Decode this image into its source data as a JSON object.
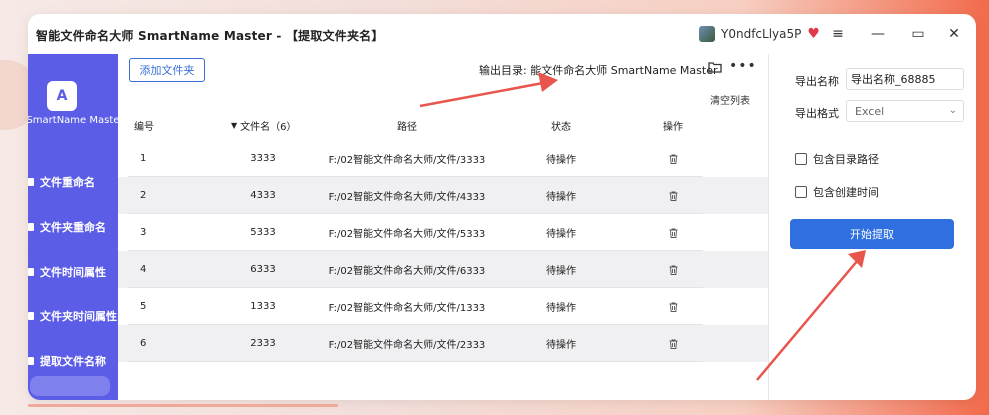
{
  "window": {
    "title": "智能文件命名大师 SmartName Master - 【提取文件夹名】",
    "user_name": "Y0ndfcLlya5P",
    "controls": [
      "menu-icon",
      "minimize-icon",
      "maximize-icon",
      "close-icon"
    ]
  },
  "sidebar": {
    "logo_label": "SmartName Master",
    "items": [
      {
        "label": "文件重命名"
      },
      {
        "label": "文件夹重命名"
      },
      {
        "label": "文件时间属性"
      },
      {
        "label": "文件夹时间属性"
      },
      {
        "label": "提取文件名称"
      }
    ]
  },
  "toolbar": {
    "add_folder_label": "添加文件夹",
    "output_dir_prefix": "输出目录:",
    "output_dir_value": "能文件命名大师 SmartName Master",
    "clear_list_label": "清空列表"
  },
  "table": {
    "headers": {
      "id": "编号",
      "name": "文件名（6）",
      "path": "路径",
      "status": "状态",
      "op": "操作"
    },
    "rows": [
      {
        "id": "1",
        "name": "3333",
        "path": "F:/02智能文件命名大师/文件/3333",
        "status": "待操作"
      },
      {
        "id": "2",
        "name": "4333",
        "path": "F:/02智能文件命名大师/文件/4333",
        "status": "待操作"
      },
      {
        "id": "3",
        "name": "5333",
        "path": "F:/02智能文件命名大师/文件/5333",
        "status": "待操作"
      },
      {
        "id": "4",
        "name": "6333",
        "path": "F:/02智能文件命名大师/文件/6333",
        "status": "待操作"
      },
      {
        "id": "5",
        "name": "1333",
        "path": "F:/02智能文件命名大师/文件/1333",
        "status": "待操作"
      },
      {
        "id": "6",
        "name": "2333",
        "path": "F:/02智能文件命名大师/文件/2333",
        "status": "待操作"
      }
    ]
  },
  "panel": {
    "export_name_label": "导出名称",
    "export_name_value": "导出名称_68885",
    "export_format_label": "导出格式",
    "export_format_value": "Excel",
    "include_dir_path_label": "包含目录路径",
    "include_create_time_label": "包含创建时间",
    "start_button_label": "开始提取"
  },
  "colors": {
    "accent": "#2f6fe0",
    "sidebar": "#5b5de6",
    "annotation_arrow": "#e8554c"
  }
}
